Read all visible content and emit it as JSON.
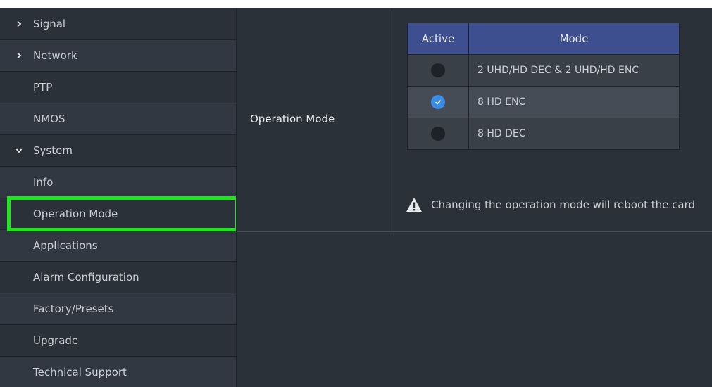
{
  "sidebar": {
    "items": [
      {
        "label": "Signal",
        "chevron": "right"
      },
      {
        "label": "Network",
        "chevron": "right"
      },
      {
        "label": "PTP",
        "chevron": ""
      },
      {
        "label": "NMOS",
        "chevron": ""
      },
      {
        "label": "System",
        "chevron": "down"
      },
      {
        "label": "Info",
        "chevron": ""
      },
      {
        "label": "Operation Mode",
        "chevron": "",
        "selected": true
      },
      {
        "label": "Applications",
        "chevron": ""
      },
      {
        "label": "Alarm Configuration",
        "chevron": ""
      },
      {
        "label": "Factory/Presets",
        "chevron": ""
      },
      {
        "label": "Upgrade",
        "chevron": ""
      },
      {
        "label": "Technical Support",
        "chevron": ""
      }
    ]
  },
  "main": {
    "row_label": "Operation Mode",
    "table": {
      "headers": {
        "active": "Active",
        "mode": "Mode"
      },
      "rows": [
        {
          "mode": "2 UHD/HD DEC & 2 UHD/HD ENC",
          "active": false
        },
        {
          "mode": "8 HD ENC",
          "active": true
        },
        {
          "mode": "8 HD DEC",
          "active": false
        }
      ]
    },
    "warning": "Changing the operation mode will reboot the card"
  },
  "colors": {
    "background": "#2b3139",
    "table_header": "#3d4f8e",
    "radio_checked": "#3b8ee8",
    "highlight": "#1fe41f"
  }
}
